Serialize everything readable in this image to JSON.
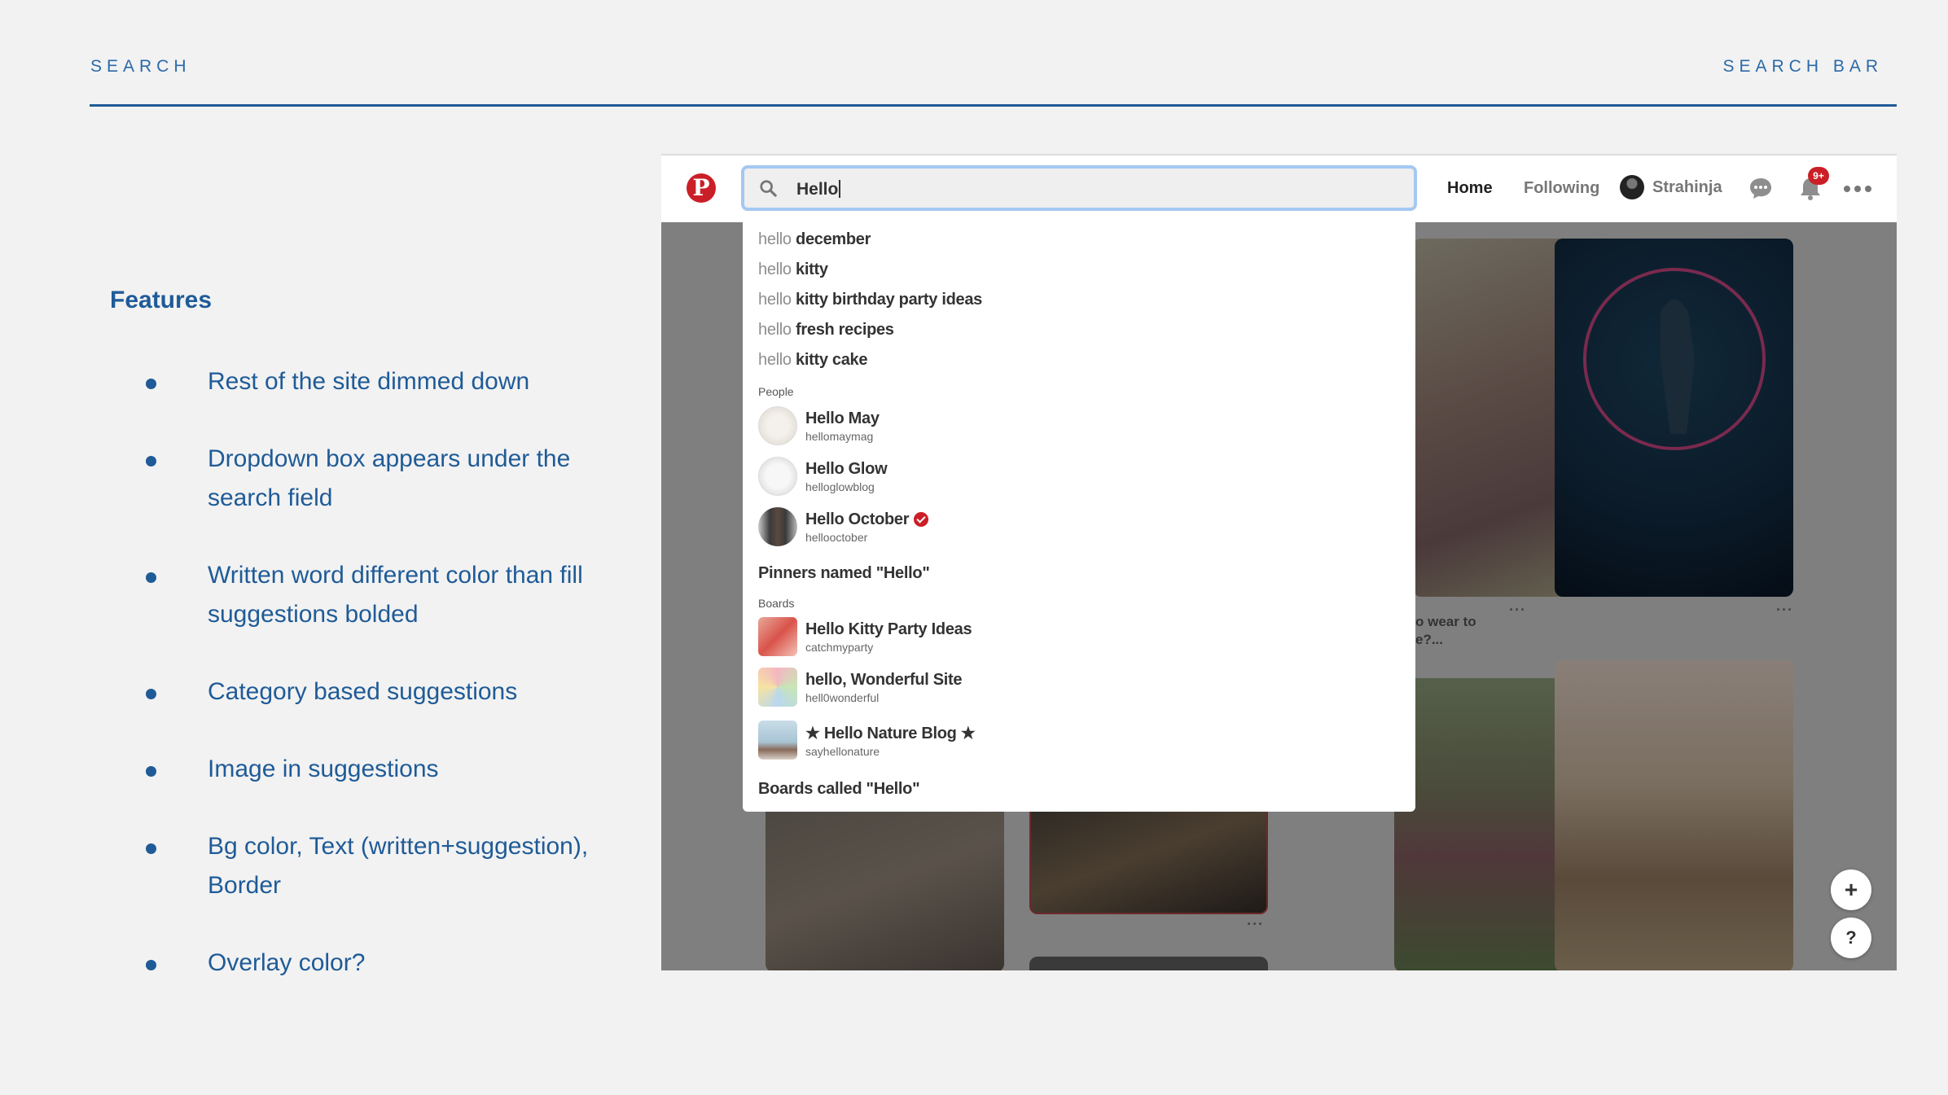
{
  "slide": {
    "header_left": "SEARCH",
    "header_right": "SEARCH BAR",
    "features_title": "Features",
    "features": [
      "Rest of the site dimmed down",
      "Dropdown box appears under the search field",
      "Written word different color than fill suggestions bolded",
      "Category based suggestions",
      "Image in suggestions",
      "Bg color, Text (written+suggestion), Border",
      "Overlay color?"
    ]
  },
  "app": {
    "logo": "P",
    "search_value": "Hello",
    "nav": {
      "home": "Home",
      "following": "Following",
      "user": "Strahinja",
      "badge": "9+"
    },
    "icons": [
      "pinterest-logo",
      "search-icon",
      "chat-icon",
      "bell-icon",
      "more-icon",
      "plus-icon",
      "help-icon"
    ],
    "feed_dots": "···",
    "feed_caption": "o wear to\ne?...",
    "fab_add": "+",
    "fab_help": "?"
  },
  "dropdown": {
    "typed": "hello",
    "suggestions": [
      " december",
      " kitty",
      " kitty birthday party ideas",
      " fresh recipes",
      " kitty cake"
    ],
    "people_label": "People",
    "people": [
      {
        "name": "Hello May",
        "handle": "hellomaymag",
        "verified": false
      },
      {
        "name": "Hello Glow",
        "handle": "helloglowblog",
        "verified": false
      },
      {
        "name": "Hello October",
        "handle": "hellooctober",
        "verified": true
      }
    ],
    "pinners_link": "Pinners named \"Hello\"",
    "boards_label": "Boards",
    "boards": [
      {
        "name": "Hello Kitty Party Ideas",
        "handle": "catchmyparty"
      },
      {
        "name": "hello, Wonderful Site",
        "handle": "hell0wonderful"
      },
      {
        "name": "★ Hello Nature Blog ★",
        "handle": "sayhellonature"
      }
    ],
    "boards_link": "Boards called \"Hello\""
  },
  "colors": {
    "accent": "#1f5b97",
    "overlay": "#7f7f7f",
    "search_border": "#a4c8f2",
    "brand_red": "#cb1f27"
  }
}
